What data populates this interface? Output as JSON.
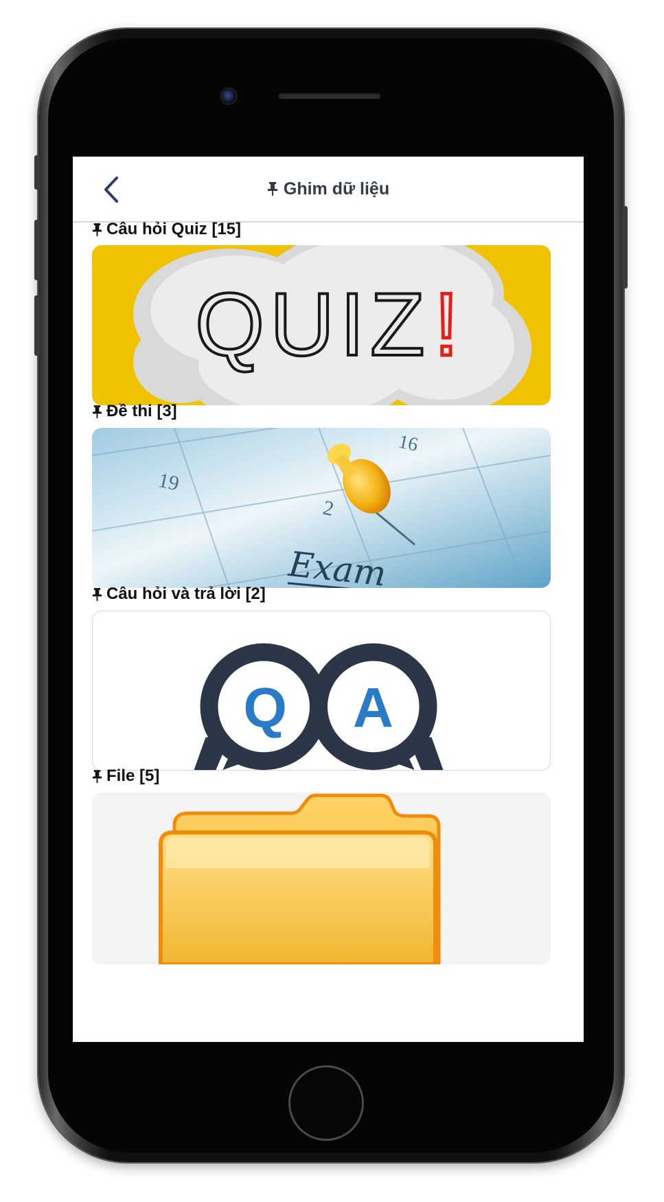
{
  "header": {
    "title": "Ghim dữ liệu",
    "back_icon": "chevron-left-icon",
    "pin_icon": "pin-icon"
  },
  "colors": {
    "header_text": "#333b46",
    "quiz_yellow": "#f0c200",
    "qa_ring": "#2b3646",
    "qa_letter": "#2a7bc7",
    "folder_orange": "#f0a020"
  },
  "sections": [
    {
      "label": "Câu hỏi Quiz [15]",
      "image_text": "QUIZ"
    },
    {
      "label": "Đề thi [3]",
      "image_numbers": [
        "19",
        "2",
        "16"
      ],
      "image_text": "Exam"
    },
    {
      "label": "Câu hỏi và trả lời [2]",
      "image_letters": [
        "Q",
        "A"
      ]
    },
    {
      "label": "File [5]"
    }
  ]
}
